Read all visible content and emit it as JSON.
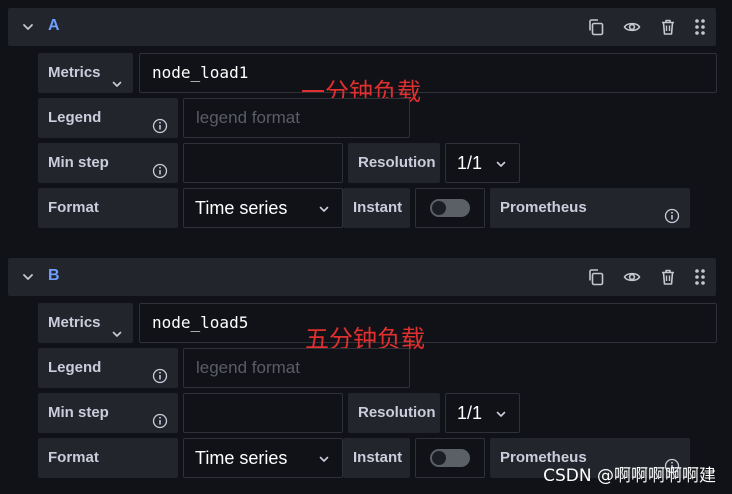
{
  "queries": [
    {
      "ref_id": "A",
      "metrics_label": "Metrics",
      "metric_query": "node_load1",
      "annotation": "一分钟负载",
      "legend_label": "Legend",
      "legend_placeholder": "legend format",
      "min_step_label": "Min step",
      "min_step_value": "",
      "resolution_label": "Resolution",
      "resolution_value": "1/1",
      "format_label": "Format",
      "format_value": "Time series",
      "instant_label": "Instant",
      "instant_enabled": false,
      "datasource_label": "Prometheus"
    },
    {
      "ref_id": "B",
      "metrics_label": "Metrics",
      "metric_query": "node_load5",
      "annotation": "五分钟负载",
      "legend_label": "Legend",
      "legend_placeholder": "legend format",
      "min_step_label": "Min step",
      "min_step_value": "",
      "resolution_label": "Resolution",
      "resolution_value": "1/1",
      "format_label": "Format",
      "format_value": "Time series",
      "instant_label": "Instant",
      "instant_enabled": false,
      "datasource_label": "Prometheus"
    }
  ],
  "header_icons": [
    "duplicate-icon",
    "eye-icon",
    "trash-icon",
    "drag-handle-icon"
  ],
  "watermark": "CSDN @啊啊啊啊啊建",
  "colors": {
    "background": "#111217",
    "panel": "#22252b",
    "ref_id": "#6e9fff",
    "annotation": "#e02f2f"
  }
}
